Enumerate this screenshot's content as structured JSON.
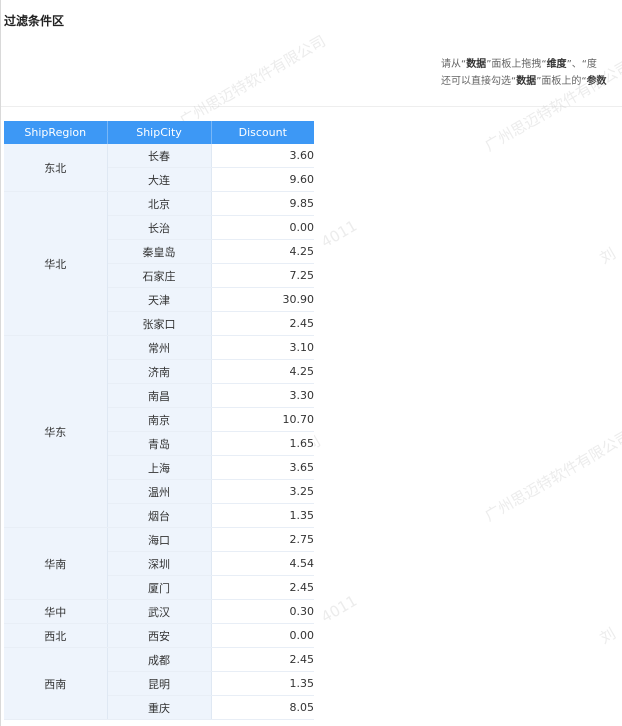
{
  "filter": {
    "title": "过滤条件区"
  },
  "hint": {
    "l1": {
      "a": "请从“",
      "b": "数据",
      "c": "”面板上拖拽“",
      "d": "维度",
      "e": "”、“度"
    },
    "l2": {
      "a": "还可以直接勾选“",
      "b": "数据",
      "c": "”面板上的“",
      "d": "参数"
    }
  },
  "watermarks": [
    "广州思迈特软件有限公司",
    "广州思迈特软件有限公司",
    "广州思迈特软件有限公司",
    "广州思迈特软件有限公司",
    "4011",
    "4011",
    "4011",
    "4011",
    "刘",
    "刘"
  ],
  "table": {
    "headers": [
      "ShipRegion",
      "ShipCity",
      "Discount"
    ],
    "groups": [
      {
        "region": "东北",
        "rows": [
          {
            "city": "长春",
            "discount": "3.60"
          },
          {
            "city": "大连",
            "discount": "9.60"
          }
        ]
      },
      {
        "region": "华北",
        "rows": [
          {
            "city": "北京",
            "discount": "9.85"
          },
          {
            "city": "长治",
            "discount": "0.00"
          },
          {
            "city": "秦皇岛",
            "discount": "4.25"
          },
          {
            "city": "石家庄",
            "discount": "7.25"
          },
          {
            "city": "天津",
            "discount": "30.90"
          },
          {
            "city": "张家口",
            "discount": "2.45"
          }
        ]
      },
      {
        "region": "华东",
        "rows": [
          {
            "city": "常州",
            "discount": "3.10"
          },
          {
            "city": "济南",
            "discount": "4.25"
          },
          {
            "city": "南昌",
            "discount": "3.30"
          },
          {
            "city": "南京",
            "discount": "10.70"
          },
          {
            "city": "青岛",
            "discount": "1.65"
          },
          {
            "city": "上海",
            "discount": "3.65"
          },
          {
            "city": "温州",
            "discount": "3.25"
          },
          {
            "city": "烟台",
            "discount": "1.35"
          }
        ]
      },
      {
        "region": "华南",
        "rows": [
          {
            "city": "海口",
            "discount": "2.75"
          },
          {
            "city": "深圳",
            "discount": "4.54"
          },
          {
            "city": "厦门",
            "discount": "2.45"
          }
        ]
      },
      {
        "region": "华中",
        "rows": [
          {
            "city": "武汉",
            "discount": "0.30"
          }
        ]
      },
      {
        "region": "西北",
        "rows": [
          {
            "city": "西安",
            "discount": "0.00"
          }
        ]
      },
      {
        "region": "西南",
        "rows": [
          {
            "city": "成都",
            "discount": "2.45"
          },
          {
            "city": "昆明",
            "discount": "1.35"
          },
          {
            "city": "重庆",
            "discount": "8.05"
          }
        ]
      }
    ]
  }
}
